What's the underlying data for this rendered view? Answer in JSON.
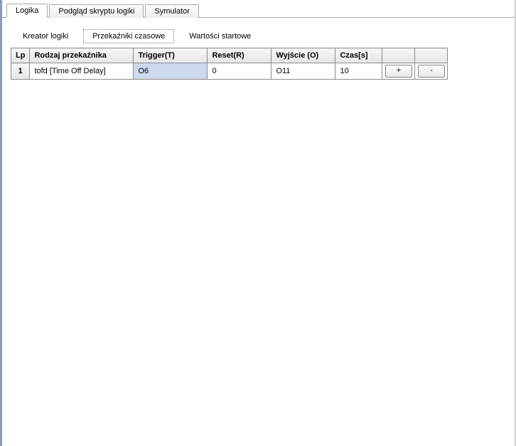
{
  "tabs": {
    "main": [
      {
        "label": "Logika",
        "active": true
      },
      {
        "label": "Podgląd skryptu logiki",
        "active": false
      },
      {
        "label": "Symulator",
        "active": false
      }
    ],
    "sub": [
      {
        "label": "Kreator logiki",
        "active": false
      },
      {
        "label": "Przekaźniki czasowe",
        "active": true
      },
      {
        "label": "Wartości startowe",
        "active": false
      }
    ]
  },
  "table": {
    "headers": {
      "lp": "Lp",
      "type": "Rodzaj przekaźnika",
      "trigger": "Trigger(T)",
      "reset": "Reset(R)",
      "output": "Wyjście (O)",
      "time": "Czas[s]",
      "add": "",
      "remove": ""
    },
    "rows": [
      {
        "lp": "1",
        "type": "tofd [Time Off Delay]",
        "trigger": "O6",
        "reset": "0",
        "output": "O11",
        "time": "10",
        "add": "+",
        "remove": "-"
      }
    ]
  }
}
